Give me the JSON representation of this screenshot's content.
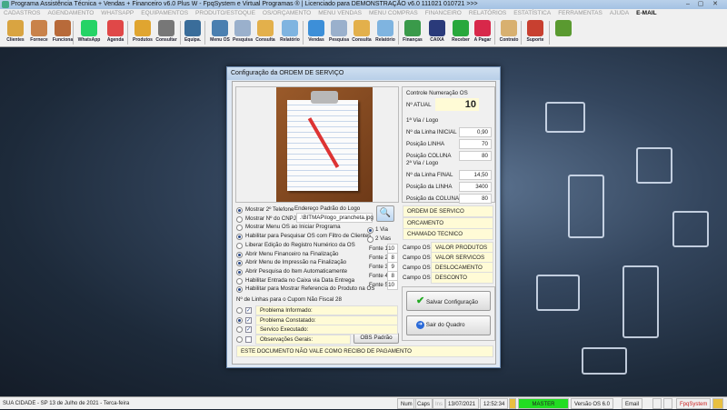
{
  "window": {
    "title": "Programa Assistência Técnica + Vendas + Financeiro v6.0 Plus W - FpqSystem e Virtual Programas ® | Licenciado para  DEMONSTRAÇÃO v6.0 111021 010721 >>>",
    "min": "–",
    "max": "▢",
    "close": "✕"
  },
  "menu": [
    "CADASTROS",
    "AGENDAMENTO",
    "WHATSAPP",
    "EQUIPAMENTOS",
    "PRODUTO/ESTOQUE",
    "OS/ORÇAMENTO",
    "MENU VENDAS",
    "MENU COMPRAS",
    "FINANCEIRO",
    "RELATÓRIOS",
    "ESTATÍSTICA",
    "FERRAMENTAS",
    "AJUDA"
  ],
  "menu_email": "E-MAIL",
  "toolbar": [
    {
      "label": "Clientes",
      "icon": "clients-icon",
      "color": "#d9a441"
    },
    {
      "label": "Fornece",
      "icon": "supplier-icon",
      "color": "#c9824a"
    },
    {
      "label": "Funciona",
      "icon": "employee-icon",
      "color": "#b86a3a"
    },
    {
      "label": "WhatsApp",
      "icon": "whatsapp-icon",
      "color": "#25d366"
    },
    {
      "label": "Agenda",
      "icon": "calendar-icon",
      "color": "#e04848"
    },
    {
      "label": "Produtos",
      "icon": "products-icon",
      "color": "#e0a530"
    },
    {
      "label": "Consultar",
      "icon": "barcode-icon",
      "color": "#777777"
    },
    {
      "label": "Equipa.",
      "icon": "equipment-icon",
      "color": "#3a6d9a"
    },
    {
      "label": "Menu OS",
      "icon": "service-order-icon",
      "color": "#4a7fb0"
    },
    {
      "label": "Pesquisa",
      "icon": "search-docs-icon",
      "color": "#9ab0cc"
    },
    {
      "label": "Consulta",
      "icon": "folder-icon",
      "color": "#e3b04b"
    },
    {
      "label": "Relatório",
      "icon": "printer-icon",
      "color": "#7fb4e0"
    },
    {
      "label": "Vendas",
      "icon": "monitor-icon",
      "color": "#3d8fd8"
    },
    {
      "label": "Pesquisa",
      "icon": "search-docs-icon",
      "color": "#9ab0cc"
    },
    {
      "label": "Consulta",
      "icon": "folder-icon",
      "color": "#e3b04b"
    },
    {
      "label": "Relatório",
      "icon": "printer-icon",
      "color": "#7fb4e0"
    },
    {
      "label": "Finanças",
      "icon": "finance-icon",
      "color": "#3a9a4a"
    },
    {
      "label": "CAIXA",
      "icon": "cashbook-icon",
      "color": "#2a3a7a"
    },
    {
      "label": "Receber",
      "icon": "receive-icon",
      "color": "#28a83c"
    },
    {
      "label": "A Pagar",
      "icon": "pay-icon",
      "color": "#d8284a"
    },
    {
      "label": "Contrato",
      "icon": "contract-icon",
      "color": "#d8b070"
    },
    {
      "label": "Suporte",
      "icon": "support-icon",
      "color": "#c84030"
    },
    {
      "label": "",
      "icon": "exit-icon",
      "color": "#5a9a30"
    }
  ],
  "dialog": {
    "title": "Configuração da ORDEM DE SERVIÇO",
    "logo_label": "Endereço Padrão do Logo",
    "logo_path": ".\\BITMAP\\logo_prancheta.jpg",
    "control_title": "Controle Numeração OS",
    "n_atual_label": "Nº ATUAL",
    "n_atual": "10",
    "via1_title": "1ª Via / Logo",
    "via1": [
      {
        "label": "Nº da Linha INICIAL",
        "value": "0,90"
      },
      {
        "label": "Posição LINHA",
        "value": "70"
      },
      {
        "label": "Posição COLUNA",
        "value": "80"
      }
    ],
    "via2_title": "2ª Via / Logo",
    "via2": [
      {
        "label": "Nº da Linha FINAL",
        "value": "14,50"
      },
      {
        "label": "Posição da LINHA",
        "value": "3400"
      },
      {
        "label": "Posição da COLUNA",
        "value": "80"
      }
    ],
    "options": [
      {
        "label": "Mostrar 2º Telefone",
        "on": true
      },
      {
        "label": "Mostrar Nº do CNPJ",
        "on": false
      },
      {
        "label": "Mostrar Menu OS ao Iniciar Programa",
        "on": false
      },
      {
        "label": "Habilitar para Pesquisar OS com Filtro de Clientes",
        "on": true
      },
      {
        "label": "Liberar Edição do Registro Numérico da OS",
        "on": false
      },
      {
        "label": "Abrir Menu Financeiro na Finalização",
        "on": true
      },
      {
        "label": "Abrir Menu de Impressão na Finalização",
        "on": true
      },
      {
        "label": "Abrir Pesquisa do Item Automaticamente",
        "on": true
      },
      {
        "label": "Habilitar Entrada no Caixa via Data Entrega",
        "on": false
      },
      {
        "label": "Habilitar para Mostrar Referencia do Produto na OS",
        "on": true
      }
    ],
    "vias": [
      {
        "label": "1 Via",
        "on": true
      },
      {
        "label": "2 Vias",
        "on": false
      }
    ],
    "fontes": [
      {
        "label": "Fonte 1",
        "value": "10"
      },
      {
        "label": "Fonte 2",
        "value": "8"
      },
      {
        "label": "Fonte 3",
        "value": "9"
      },
      {
        "label": "Fonte 4",
        "value": "8"
      },
      {
        "label": "Fonte 5",
        "value": "10"
      }
    ],
    "titles": [
      "ORDEM DE SERVICO",
      "ORCAMENTO",
      "CHAMADO TECNICO"
    ],
    "campos": [
      {
        "label": "Campo OS 1",
        "value": "VALOR PRODUTOS"
      },
      {
        "label": "Campo OS 2",
        "value": "VALOR SERVICOS"
      },
      {
        "label": "Campo OS 3",
        "value": "DESLOCAMENTO"
      },
      {
        "label": "Campo OS 4",
        "value": "DESCONTO"
      }
    ],
    "cupom_label": "Nº de Linhas para o Cupom Não Fiscal",
    "cupom_value": "28",
    "fields": [
      {
        "label": "Problema Informado:",
        "radio": false,
        "check": true
      },
      {
        "label": "Problema Constatado:",
        "radio": true,
        "check": true
      },
      {
        "label": "Servico Executado:",
        "radio": false,
        "check": true
      },
      {
        "label": "Observações Gerais:",
        "radio": false,
        "check": false
      }
    ],
    "obs_button": "OBS Padrão",
    "footer_text": "ESTE DOCUMENTO NÃO VALE COMO RECIBO DE PAGAMENTO",
    "save_button": "Salvar Configuração",
    "exit_button": "Sair do Quadro"
  },
  "status": {
    "city": "SUA CIDADE - SP 13 de Julho de 2021 - Terca-feira",
    "num": "Num",
    "caps": "Caps",
    "ins": "Ins",
    "date": "13/07/2021",
    "time": "12:52:34",
    "user": "MASTER",
    "version": "Versão OS 6.0",
    "email": "Email",
    "brand": "FpqSystem",
    "user_color": "#22dd22"
  }
}
